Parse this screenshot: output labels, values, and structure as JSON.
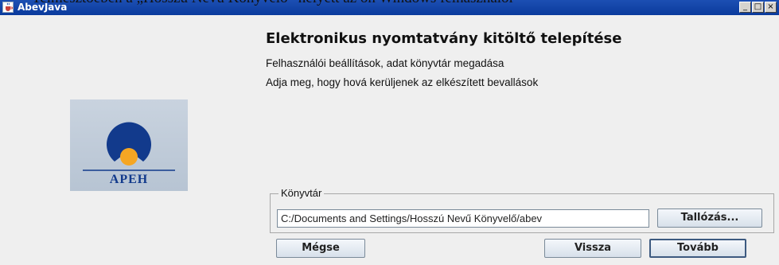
{
  "document": {
    "header_line": "Telmesztoeben a „Hosszú Nevű Könyvelő” helyett az ön Windows felhasználói"
  },
  "window": {
    "title": "AbevJava",
    "controls": {
      "minimize": "_",
      "maximize": "□",
      "close": "×"
    }
  },
  "header": {
    "title": "Elektronikus nyomtatvány kitöltő telepítése",
    "subtitle": "Felhasználói beállítások, adat könyvtár megadása",
    "instruction": "Adja meg, hogy hová kerüljenek az elkészített bevallások"
  },
  "logo": {
    "text": "APEH"
  },
  "directory": {
    "legend": "Könyvtár",
    "path_value": "C:/Documents and Settings/Hosszú Nevű Könyvelő/abev",
    "browse_label": "Tallózás..."
  },
  "footer": {
    "cancel_label": "Mégse",
    "back_label": "Vissza",
    "next_label": "Tovább"
  },
  "colors": {
    "titlebar": "#0a3a9c",
    "logo_blue": "#123a8c",
    "logo_orange": "#f5a623",
    "window_bg": "#efefef"
  }
}
